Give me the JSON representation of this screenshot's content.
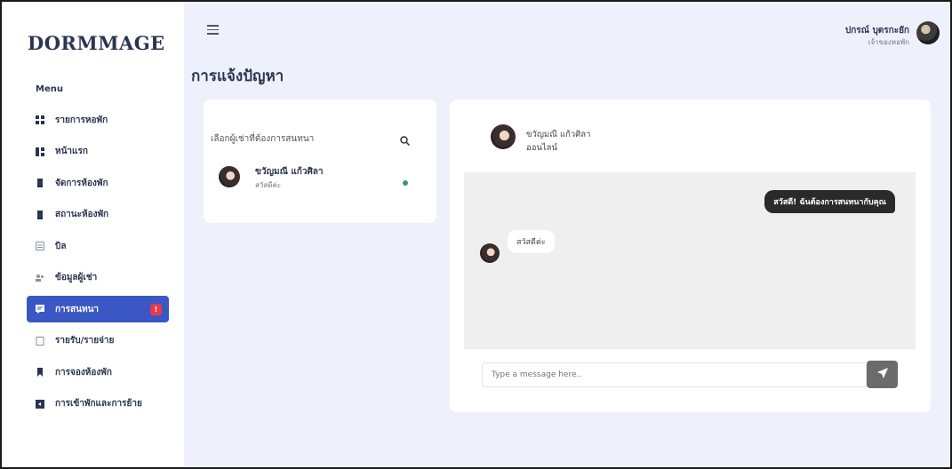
{
  "app": {
    "brand": "DORMMAGE"
  },
  "sidebar": {
    "menu_title": "Menu",
    "items": [
      {
        "label": "รายการหอพัก",
        "icon": "grid-icon"
      },
      {
        "label": "หน้าแรก",
        "icon": "dashboard-icon"
      },
      {
        "label": "จัดการห้องพัก",
        "icon": "door-icon"
      },
      {
        "label": "สถานะห้องพัก",
        "icon": "door-status-icon"
      },
      {
        "label": "บิล",
        "icon": "bill-icon"
      },
      {
        "label": "ข้อมูลผู้เช่า",
        "icon": "users-icon"
      },
      {
        "label": "การสนทนา",
        "icon": "chat-icon",
        "active": true,
        "badge": "!"
      },
      {
        "label": "รายรับ/รายจ่าย",
        "icon": "clipboard-icon"
      },
      {
        "label": "การจองห้องพัก",
        "icon": "bookmark-icon"
      },
      {
        "label": "การเข้าพักและการย้าย",
        "icon": "move-icon"
      }
    ]
  },
  "header": {
    "user_name": "ปกรณ์ บุตรกะยัก",
    "user_role": "เจ้าของหอพัก"
  },
  "page": {
    "title": "การแจ้งปัญหา"
  },
  "contacts": {
    "search_label": "เลือกผู้เช่าที่ต้องการสนทนา",
    "items": [
      {
        "name": "ขวัญมณี แก้วศิลา",
        "last_message": "สวัสดีค่ะ",
        "online": true
      }
    ]
  },
  "chat": {
    "name": "ขวัญมณี แก้วศิลา",
    "status": "ออนไลน์",
    "messages": [
      {
        "direction": "out",
        "text": "สวัสดี! ฉันต้องการสนทนากับคุณ"
      },
      {
        "direction": "in",
        "text": "สวัสดีค่ะ"
      }
    ],
    "input_placeholder": "Type a message here.."
  },
  "colors": {
    "accent": "#3a57c4",
    "badge": "#e53b4a",
    "online": "#2e9e5b",
    "main_bg": "#eef1fb"
  }
}
